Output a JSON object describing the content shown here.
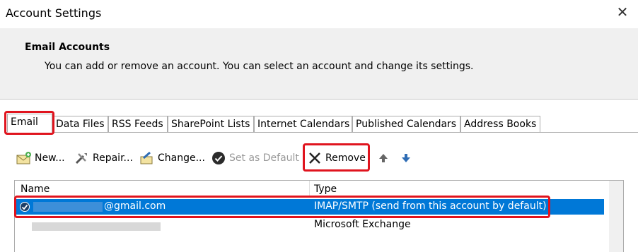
{
  "window": {
    "title": "Account Settings",
    "close_label": "✕"
  },
  "header": {
    "title": "Email Accounts",
    "subtitle": "You can add or remove an account. You can select an account and change its settings."
  },
  "tabs": [
    "Email",
    "Data Files",
    "RSS Feeds",
    "SharePoint Lists",
    "Internet Calendars",
    "Published Calendars",
    "Address Books"
  ],
  "toolbar": {
    "new": "New...",
    "repair": "Repair...",
    "change": "Change...",
    "set_default": "Set as Default",
    "remove": "Remove"
  },
  "table": {
    "headers": [
      "Name",
      "Type"
    ],
    "rows": [
      {
        "name": "@gmail.com",
        "type": "IMAP/SMTP (send from this account by default)",
        "selected": true
      },
      {
        "name": "",
        "type": "Microsoft Exchange",
        "selected": false
      }
    ]
  },
  "colors": {
    "selection": "#0078d7",
    "highlight": "#e0141e"
  }
}
